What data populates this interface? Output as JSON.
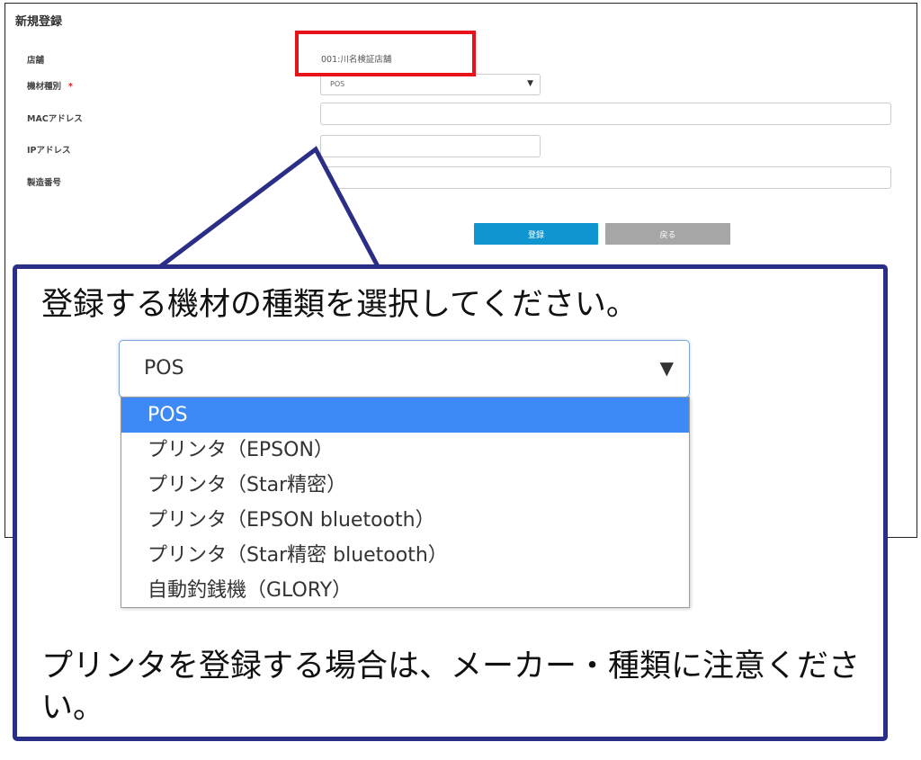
{
  "form": {
    "title": "新規登録",
    "fields": {
      "store": {
        "label": "店舗",
        "value": "001:川名検証店舗"
      },
      "equipment_type": {
        "label": "機材種別",
        "required_mark": "*",
        "value": "POS"
      },
      "mac_address": {
        "label": "MACアドレス",
        "value": ""
      },
      "ip_address": {
        "label": "IPアドレス",
        "value": ""
      },
      "serial_number": {
        "label": "製造番号",
        "value": ""
      }
    },
    "buttons": {
      "register": "登録",
      "back": "戻る"
    }
  },
  "callout": {
    "instruction_top": "登録する機材の種類を選択してください。",
    "instruction_bottom": "プリンタを登録する場合は、メーカー・種類に注意ください。",
    "dropdown": {
      "selected": "POS",
      "arrow": "▼",
      "options": [
        "POS",
        "プリンタ（EPSON）",
        "プリンタ（Star精密）",
        "プリンタ（EPSON bluetooth）",
        "プリンタ（Star精密 bluetooth）",
        "自動釣銭機（GLORY）"
      ]
    }
  },
  "colors": {
    "highlight": "#e8121b",
    "callout_border": "#2b2e86",
    "register_button": "#0f95cf",
    "back_button": "#a6a6a6",
    "option_selected": "#3d8af7"
  }
}
